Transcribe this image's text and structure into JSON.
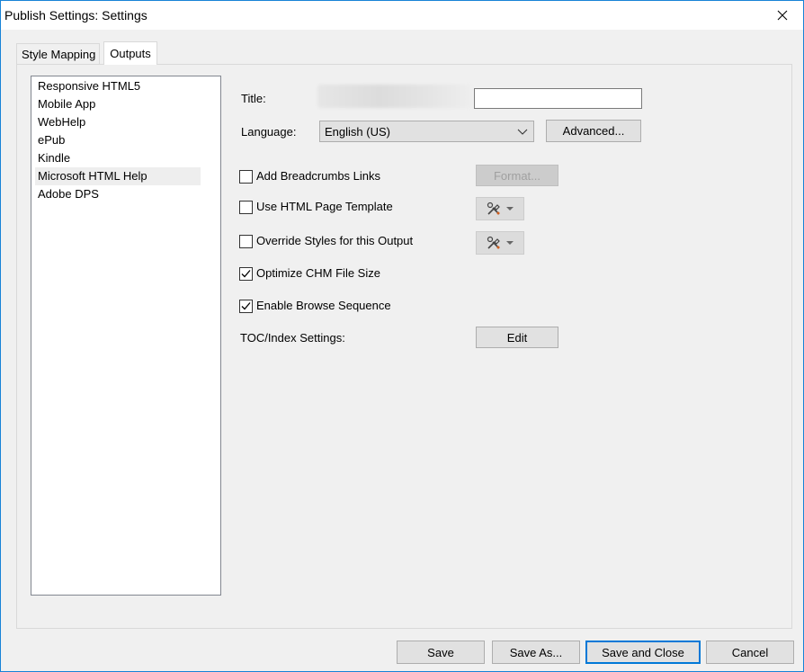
{
  "window": {
    "title": "Publish Settings: Settings"
  },
  "tabs": [
    {
      "label": "Style Mapping",
      "active": false
    },
    {
      "label": "Outputs",
      "active": true
    }
  ],
  "outputs": {
    "items": [
      "Responsive HTML5",
      "Mobile App",
      "WebHelp",
      "ePub",
      "Kindle",
      "Microsoft HTML Help",
      "Adobe DPS"
    ],
    "selected": "Microsoft HTML Help"
  },
  "form": {
    "title_label": "Title:",
    "title_value": "",
    "language_label": "Language:",
    "language_value": "English (US)",
    "advanced_label": "Advanced...",
    "breadcrumbs_label": "Add Breadcrumbs Links",
    "breadcrumbs_checked": false,
    "format_label": "Format...",
    "page_template_label": "Use HTML Page Template",
    "page_template_checked": false,
    "override_styles_label": "Override Styles for this Output",
    "override_styles_checked": false,
    "optimize_label": "Optimize CHM File Size",
    "optimize_checked": true,
    "browse_sequence_label": "Enable Browse Sequence",
    "browse_sequence_checked": true,
    "toc_label": "TOC/Index Settings:",
    "edit_label": "Edit"
  },
  "footer": {
    "save": "Save",
    "save_as": "Save As...",
    "save_and_close": "Save and Close",
    "cancel": "Cancel"
  },
  "icons": {
    "close": "close-icon",
    "chevron": "chevron-down-icon",
    "tools": "tools-icon",
    "check": "checkmark-icon"
  },
  "colors": {
    "window_border": "#1883d7",
    "default_button_border": "#0078d7",
    "selection": "#eeeeee"
  }
}
